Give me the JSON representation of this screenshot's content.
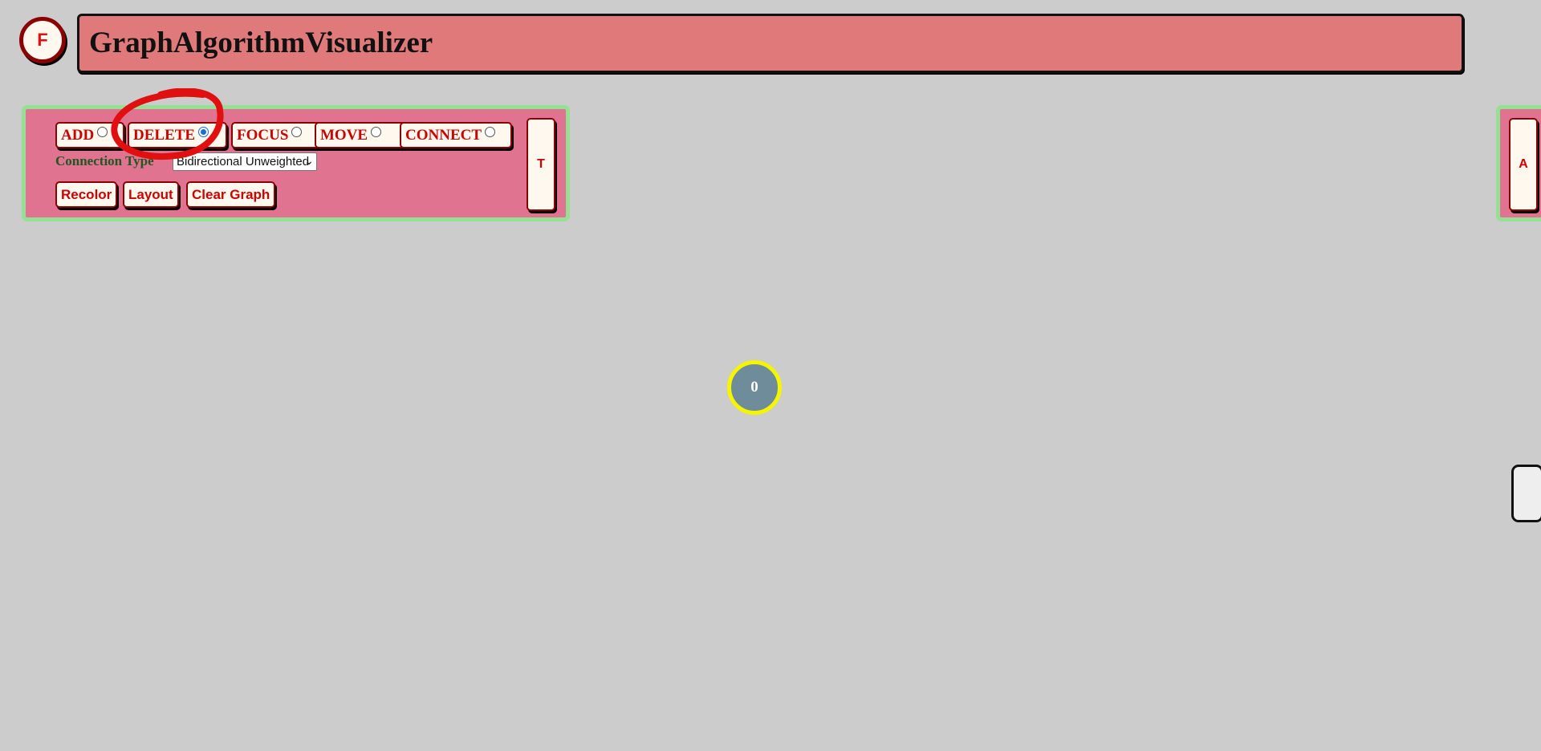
{
  "header": {
    "fab_label": "F",
    "title": "GraphAlgorithmVisualizer"
  },
  "toolbar": {
    "modes": [
      {
        "label": "ADD",
        "checked": false
      },
      {
        "label": "DELETE",
        "checked": true
      },
      {
        "label": "FOCUS",
        "checked": false
      },
      {
        "label": "MOVE",
        "checked": false
      },
      {
        "label": "CONNECT",
        "checked": false
      }
    ],
    "connection_label": "Connection Type",
    "connection_value": "Bidirectional Unweighted",
    "actions": {
      "recolor": "Recolor",
      "layout": "Layout",
      "clear": "Clear Graph"
    },
    "side_tab_label": "T"
  },
  "right_panel": {
    "tab_label": "A"
  },
  "graph": {
    "nodes": [
      {
        "id": "0",
        "fill": "#6e8c9a",
        "stroke": "#f5f500"
      }
    ]
  },
  "colors": {
    "background": "#cccccc",
    "title_bar": "#e07a7a",
    "panel": "#df7390",
    "panel_border": "#95e095",
    "button_text": "#cc0000",
    "annotation": "#e01010"
  }
}
